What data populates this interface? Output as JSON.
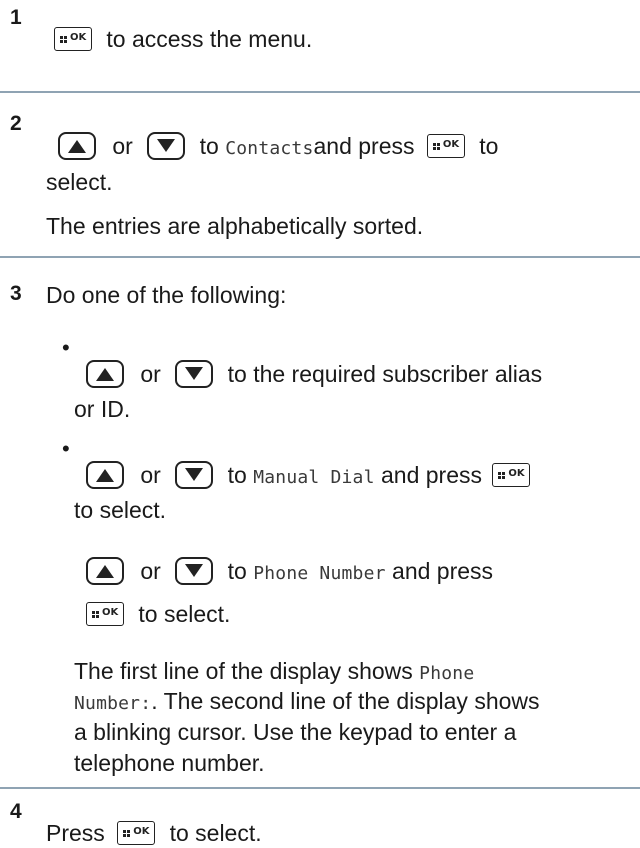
{
  "icons": {
    "ok_key": "menu-ok-key-icon",
    "up_key": "up-arrow-key-icon",
    "down_key": "down-arrow-key-icon"
  },
  "steps": [
    {
      "number": "1",
      "text": "to access the menu."
    },
    {
      "number": "2",
      "or": "or",
      "to": "to",
      "menu_item": "Contacts",
      "and_press": "and press",
      "to_select_part": "to",
      "select_part": "select.",
      "note": "The entries are alphabetically sorted."
    },
    {
      "number": "3",
      "intro": "Do one of the following:",
      "options": [
        {
          "or": "or",
          "text_line1": "to the required subscriber alias",
          "text_line2": "or ID."
        },
        {
          "or": "or",
          "to": "to",
          "menu_item": "Manual Dial",
          "and_press": "and press",
          "text_line2": "to select."
        }
      ],
      "sub": {
        "or": "or",
        "to": "to",
        "menu_item": "Phone Number",
        "and_press": "and press",
        "to_select": "to select.",
        "para_line1_text": "The first line of the display shows",
        "para_line1_mono": "Phone",
        "para_line2_mono": "Number:",
        "para_line2_text": ". The second line of the display shows",
        "para_line3": "a blinking cursor. Use the keypad to enter a",
        "para_line4": "telephone number."
      }
    },
    {
      "number": "4",
      "press": "Press",
      "to_select": "to select."
    }
  ]
}
